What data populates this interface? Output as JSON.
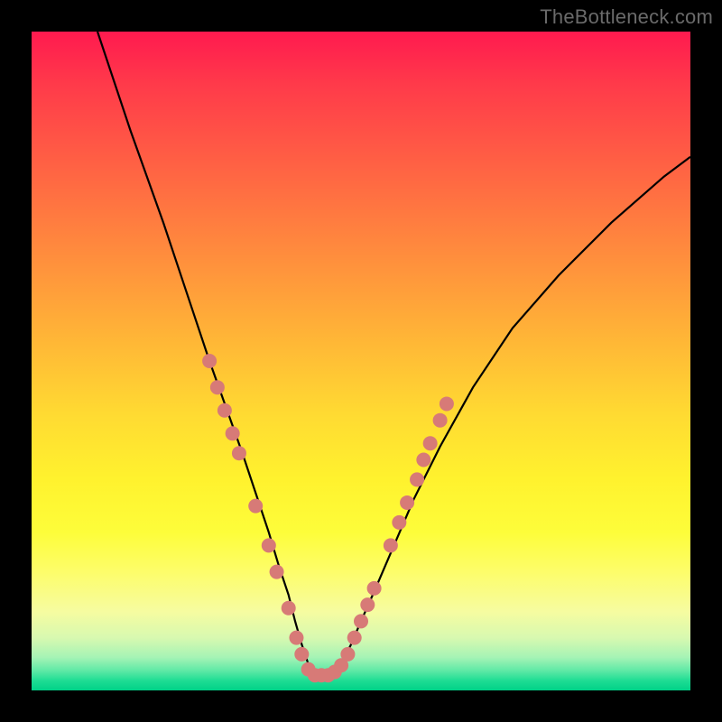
{
  "watermark": "TheBottleneck.com",
  "colors": {
    "background": "#000000",
    "curve_stroke": "#000000",
    "marker_fill": "#d77a77",
    "gradient_top": "#ff1a4f",
    "gradient_bottom": "#00d187"
  },
  "chart_data": {
    "type": "line",
    "title": "",
    "xlabel": "",
    "ylabel": "",
    "xlim": [
      0,
      100
    ],
    "ylim": [
      0,
      100
    ],
    "grid": false,
    "curve": {
      "description": "V-shaped bottleneck curve; y is bottleneck percentage (0 at notch, 100 at top).",
      "x": [
        10,
        15,
        20,
        24,
        27,
        29.5,
        32,
        34,
        36,
        37.5,
        39,
        40,
        41,
        42,
        43,
        44,
        45.5,
        47,
        48.5,
        50,
        52,
        55,
        58,
        62,
        67,
        73,
        80,
        88,
        96,
        100
      ],
      "y": [
        100,
        85,
        71,
        59,
        50,
        43,
        36,
        30,
        24,
        19,
        14.5,
        10.5,
        7,
        4,
        2.3,
        2.3,
        2.3,
        4,
        7,
        10.5,
        15,
        22,
        29,
        37,
        46,
        55,
        63,
        71,
        78,
        81
      ]
    },
    "markers": {
      "description": "Salmon dots scattered along lower portion of curve near notch.",
      "points": [
        {
          "x": 27.0,
          "y": 50
        },
        {
          "x": 28.2,
          "y": 46
        },
        {
          "x": 29.3,
          "y": 42.5
        },
        {
          "x": 30.5,
          "y": 39
        },
        {
          "x": 31.5,
          "y": 36
        },
        {
          "x": 34.0,
          "y": 28
        },
        {
          "x": 36.0,
          "y": 22
        },
        {
          "x": 37.2,
          "y": 18
        },
        {
          "x": 39.0,
          "y": 12.5
        },
        {
          "x": 40.2,
          "y": 8
        },
        {
          "x": 41.0,
          "y": 5.5
        },
        {
          "x": 42.0,
          "y": 3.2
        },
        {
          "x": 43.0,
          "y": 2.3
        },
        {
          "x": 44.0,
          "y": 2.3
        },
        {
          "x": 45.0,
          "y": 2.3
        },
        {
          "x": 46.0,
          "y": 2.8
        },
        {
          "x": 47.0,
          "y": 3.8
        },
        {
          "x": 48.0,
          "y": 5.5
        },
        {
          "x": 49.0,
          "y": 8
        },
        {
          "x": 50.0,
          "y": 10.5
        },
        {
          "x": 51.0,
          "y": 13
        },
        {
          "x": 52.0,
          "y": 15.5
        },
        {
          "x": 54.5,
          "y": 22
        },
        {
          "x": 55.8,
          "y": 25.5
        },
        {
          "x": 57.0,
          "y": 28.5
        },
        {
          "x": 58.5,
          "y": 32
        },
        {
          "x": 59.5,
          "y": 35
        },
        {
          "x": 60.5,
          "y": 37.5
        },
        {
          "x": 62.0,
          "y": 41
        },
        {
          "x": 63.0,
          "y": 43.5
        }
      ],
      "radius": 8
    }
  }
}
